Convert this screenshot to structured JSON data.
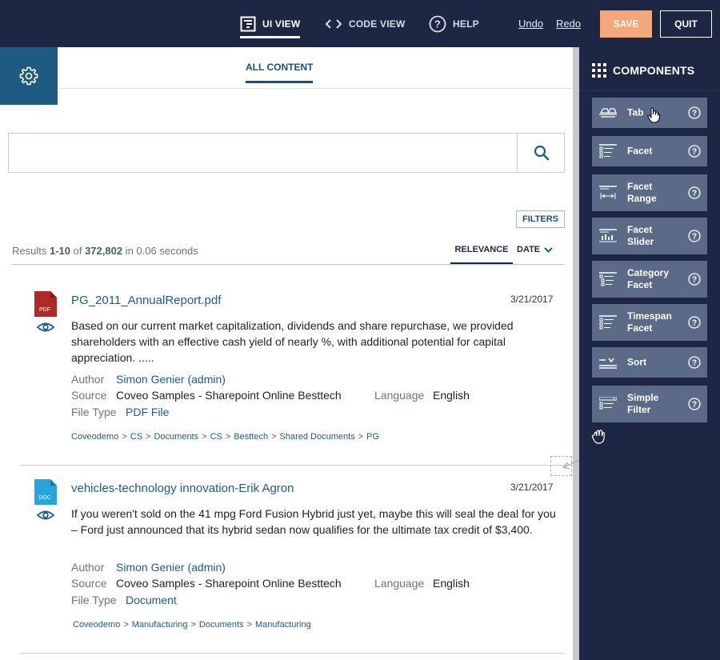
{
  "topbar": {
    "ui_view": "UI VIEW",
    "code_view": "CODE VIEW",
    "help": "HELP",
    "undo": "Undo",
    "redo": "Redo",
    "save": "SAVE",
    "quit": "QUIT"
  },
  "tabs": {
    "all_content": "ALL CONTENT"
  },
  "search": {
    "value": "",
    "placeholder": ""
  },
  "filters_label": "FILTERS",
  "summary": {
    "prefix": "Results ",
    "range": "1-10",
    "of": " of ",
    "total": "372,802",
    "suffix": " in 0.06 seconds"
  },
  "sort": {
    "relevance": "RELEVANCE",
    "date": "DATE"
  },
  "results": [
    {
      "file_type_badge": "PDF",
      "title": "PG_2011_AnnualReport.pdf",
      "date": "3/21/2017",
      "excerpt": "Based on our current market capitalization, dividends and share repurchase, we provided shareholders with an effective cash yield of nearly %, with additional potential for capital appreciation. .....",
      "author_label": "Author",
      "author": "Simon Genier (admin)",
      "source_label": "Source",
      "source": "Coveo Samples - Sharepoint Online Besttech",
      "language_label": "Language",
      "language": "English",
      "filetype_label": "File Type",
      "filetype": "PDF File",
      "breadcrumbs": [
        "Coveodemo",
        "CS",
        "Documents",
        "CS",
        "Besttech",
        "Shared Documents",
        "PG"
      ]
    },
    {
      "file_type_badge": "DOC",
      "title": "vehicles-technology innovation-Erik Agron",
      "date": "3/21/2017",
      "excerpt": "If you weren't sold on the 41 mpg Ford Fusion Hybrid just yet, maybe this will seal the deal for you – Ford just announced that its hybrid sedan now qualifies for the ultimate tax credit of $3,400.",
      "author_label": "Author",
      "author": "Simon Genier (admin)",
      "source_label": "Source",
      "source": "Coveo Samples - Sharepoint Online Besttech",
      "language_label": "Language",
      "language": "English",
      "filetype_label": "File Type",
      "filetype": "Document",
      "breadcrumbs": [
        "Coveodemo",
        "Manufacturing",
        "Documents",
        "Manufacturing"
      ]
    }
  ],
  "components_panel": {
    "title": "COMPONENTS",
    "items": [
      {
        "label_1": "Tab",
        "label_2": "",
        "icon": "tab-icon"
      },
      {
        "label_1": "Facet",
        "label_2": "",
        "icon": "facet-icon"
      },
      {
        "label_1": "Facet",
        "label_2": "Range",
        "icon": "facet-range-icon"
      },
      {
        "label_1": "Facet",
        "label_2": "Slider",
        "icon": "facet-slider-icon"
      },
      {
        "label_1": "Category",
        "label_2": "Facet",
        "icon": "category-facet-icon"
      },
      {
        "label_1": "Timespan",
        "label_2": "Facet",
        "icon": "timespan-facet-icon"
      },
      {
        "label_1": "Sort",
        "label_2": "",
        "icon": "sort-icon"
      },
      {
        "label_1": "Simple",
        "label_2": "Filter",
        "icon": "simple-filter-icon"
      }
    ]
  },
  "colors": {
    "topbar": "#1d2744",
    "save": "#f5a77c",
    "accent": "#1f5a82",
    "component_tile": "#5b6a86"
  }
}
